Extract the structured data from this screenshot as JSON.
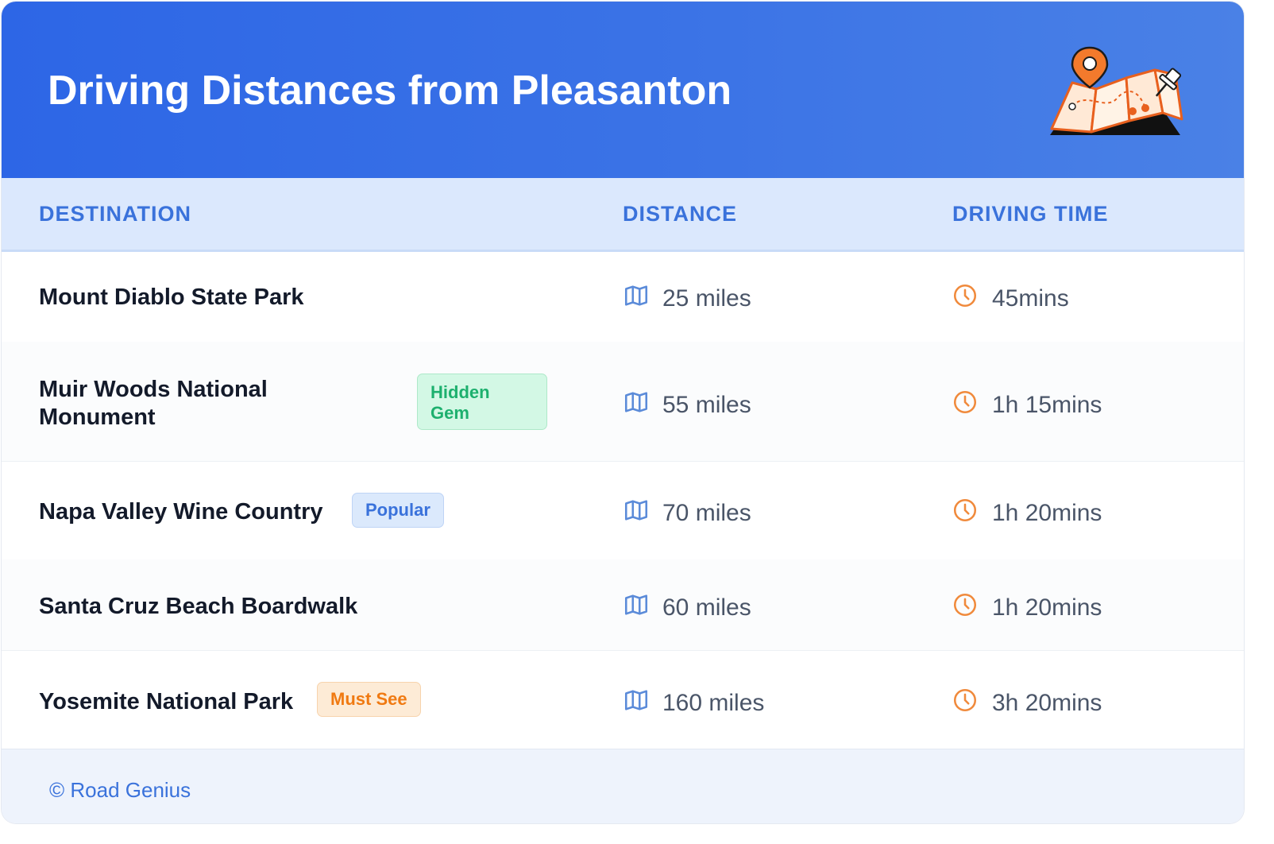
{
  "header": {
    "title": "Driving Distances from Pleasanton",
    "illustration_icon": "map-pin-icon"
  },
  "table": {
    "columns": [
      "DESTINATION",
      "DISTANCE",
      "DRIVING TIME"
    ],
    "rows": [
      {
        "destination": "Mount Diablo State Park",
        "badge": "",
        "distance": "25 miles",
        "time": "45mins"
      },
      {
        "destination": "Muir Woods National Monument",
        "destination_line1": "Muir Woods National",
        "destination_line2": "Monument",
        "badge_line1": "Hidden",
        "badge_line2": "Gem",
        "badge": "Hidden Gem",
        "distance": "55 miles",
        "time": "1h 15mins"
      },
      {
        "destination": "Napa Valley Wine Country",
        "badge": "Popular",
        "distance": "70 miles",
        "time": "1h 20mins"
      },
      {
        "destination": "Santa Cruz Beach Boardwalk",
        "badge": "",
        "distance": "60 miles",
        "time": "1h 20mins"
      },
      {
        "destination": "Yosemite National Park",
        "badge": "Must See",
        "distance": "160 miles",
        "time": "3h 20mins"
      }
    ],
    "distance_icon": "map-icon",
    "time_icon": "clock-icon"
  },
  "footer": {
    "text": "© Road Genius"
  },
  "colors": {
    "header_bg": "#2d66e6",
    "accent_blue": "#3a72db",
    "accent_orange": "#f08a3c",
    "badge_green": "#1db06e",
    "badge_orange": "#f07a12"
  }
}
